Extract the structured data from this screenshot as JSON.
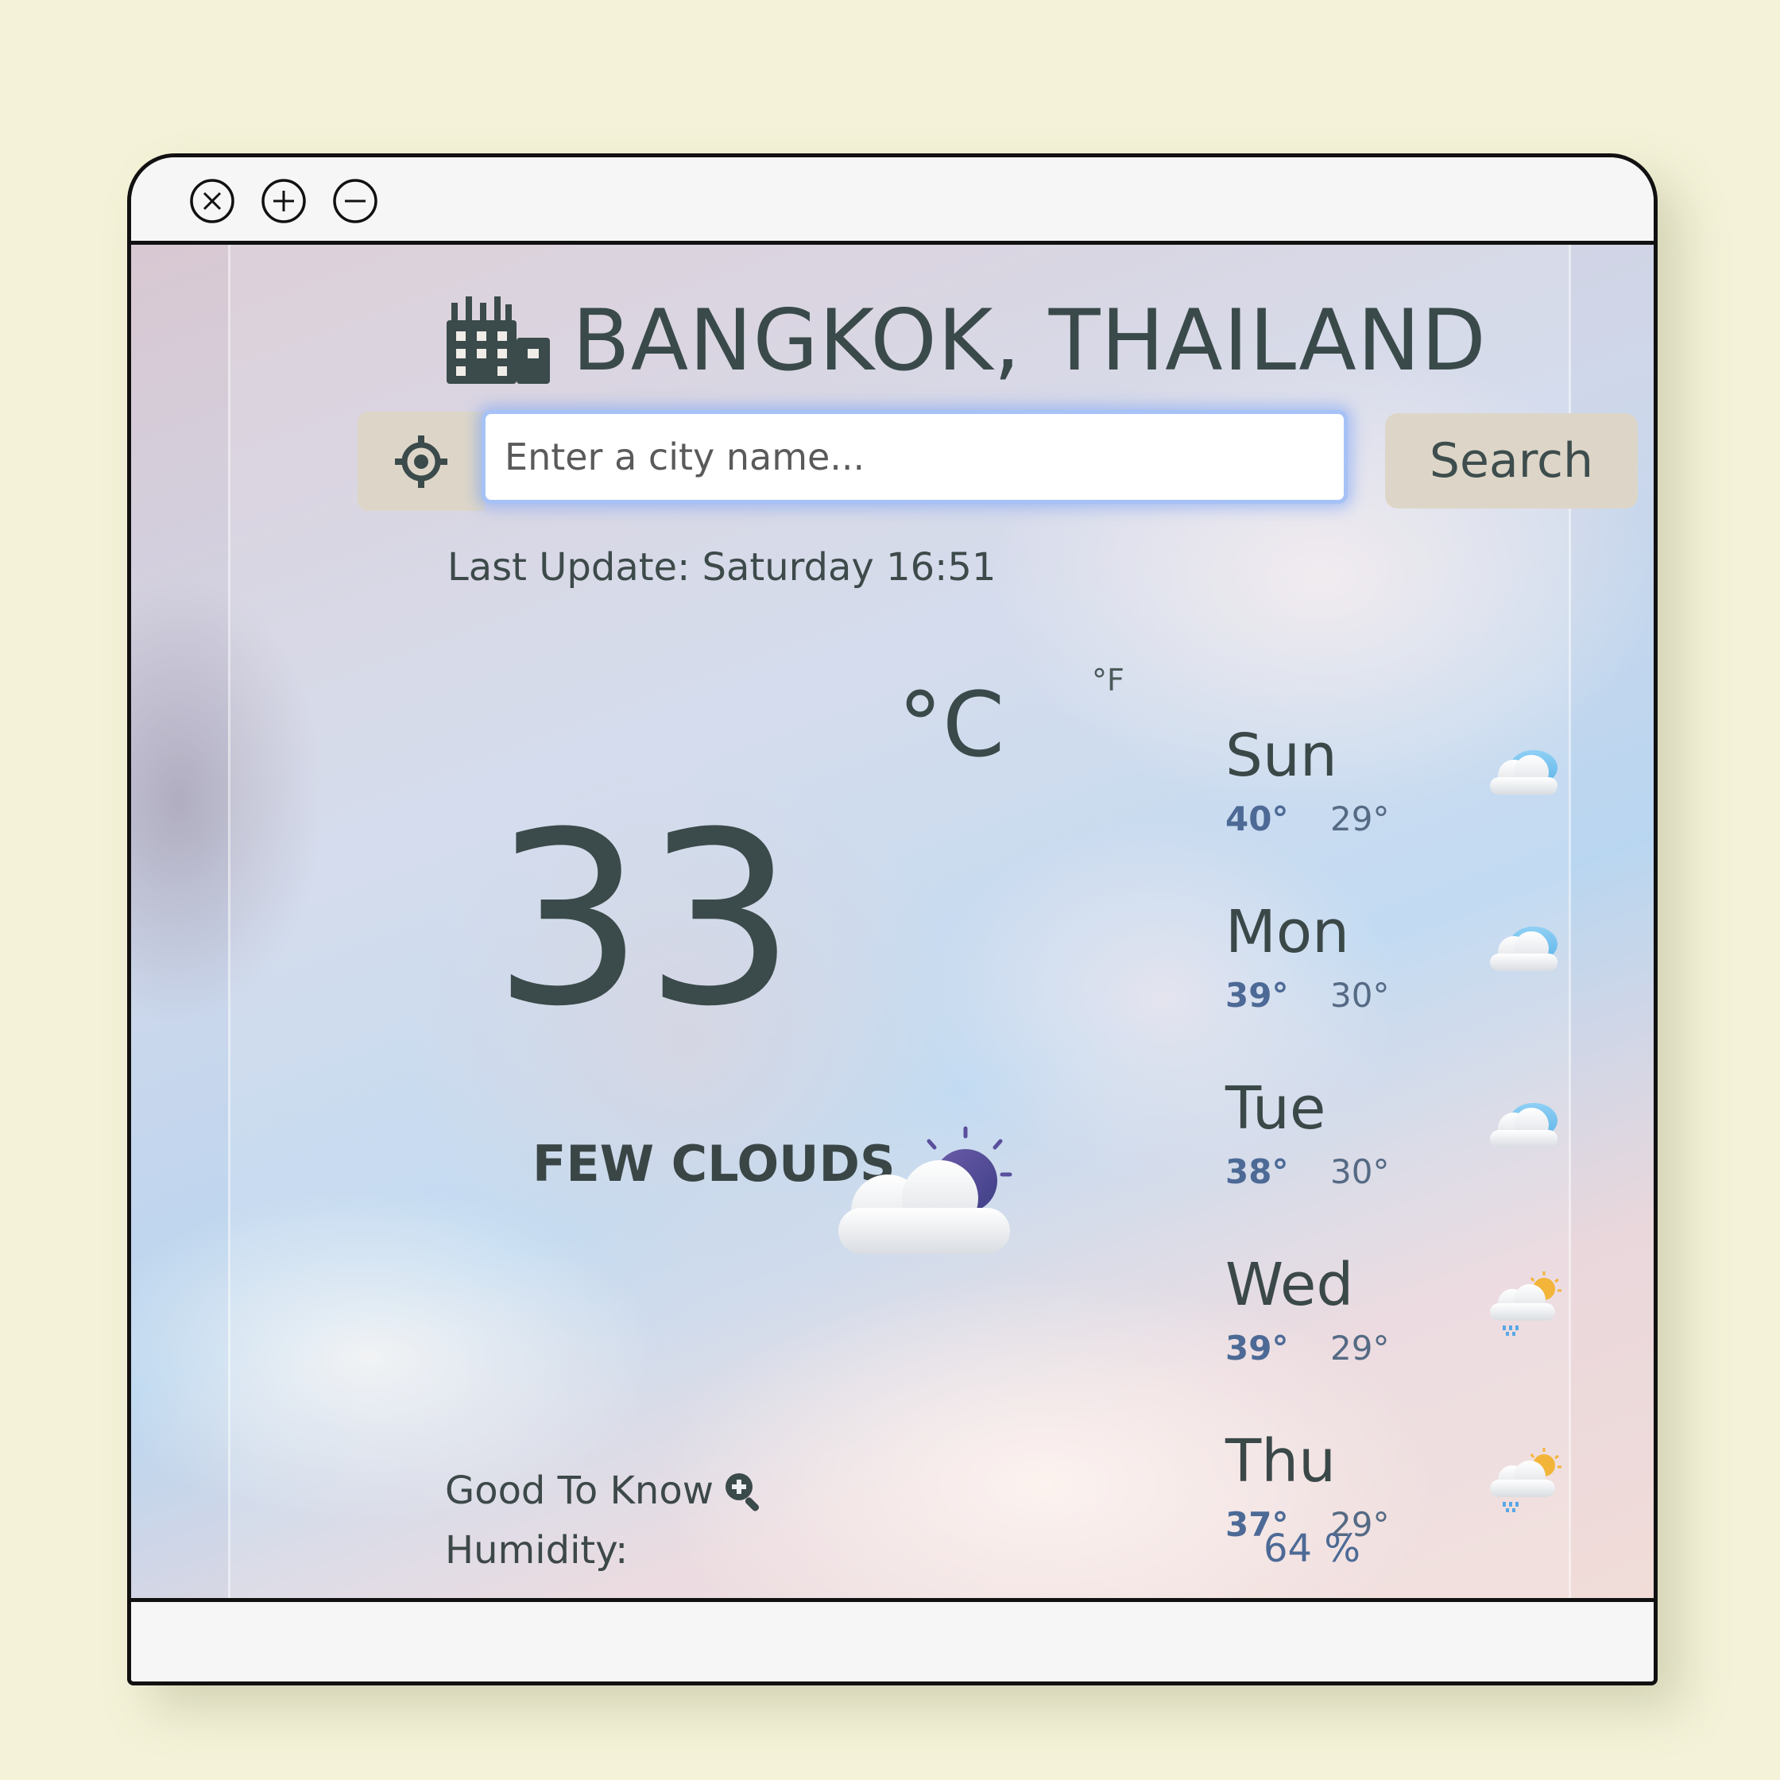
{
  "header": {
    "city": "BANGKOK, THAILAND",
    "city_icon": "city-buildings-icon"
  },
  "search": {
    "placeholder": "Enter a city name...",
    "value": "",
    "button_label": "Search",
    "locate_icon": "crosshair-icon"
  },
  "current": {
    "last_update": "Last Update: Saturday 16:51",
    "temperature": "33",
    "unit_primary": "°C",
    "unit_secondary": "°F",
    "condition": "FEW CLOUDS",
    "icon": "few-clouds-night-icon"
  },
  "forecast": [
    {
      "day": "Sun",
      "high": "40°",
      "low": "29°",
      "icon": "cloud-icon"
    },
    {
      "day": "Mon",
      "high": "39°",
      "low": "30°",
      "icon": "cloud-icon"
    },
    {
      "day": "Tue",
      "high": "38°",
      "low": "30°",
      "icon": "cloud-icon"
    },
    {
      "day": "Wed",
      "high": "39°",
      "low": "29°",
      "icon": "sun-rain-cloud-icon"
    },
    {
      "day": "Thu",
      "high": "37°",
      "low": "29°",
      "icon": "sun-rain-cloud-icon"
    }
  ],
  "details": {
    "title": "Good To Know",
    "title_icon": "zoom-in-icon",
    "humidity_label": "Humidity:",
    "humidity_value": "64 %"
  },
  "colors": {
    "page_background": "#f4f3d9",
    "text_dark": "#3a4a4a",
    "accent_blue": "#4d6a96",
    "button_beige": "#ddd6c8",
    "input_focus_glow": "#a6c2f6"
  }
}
